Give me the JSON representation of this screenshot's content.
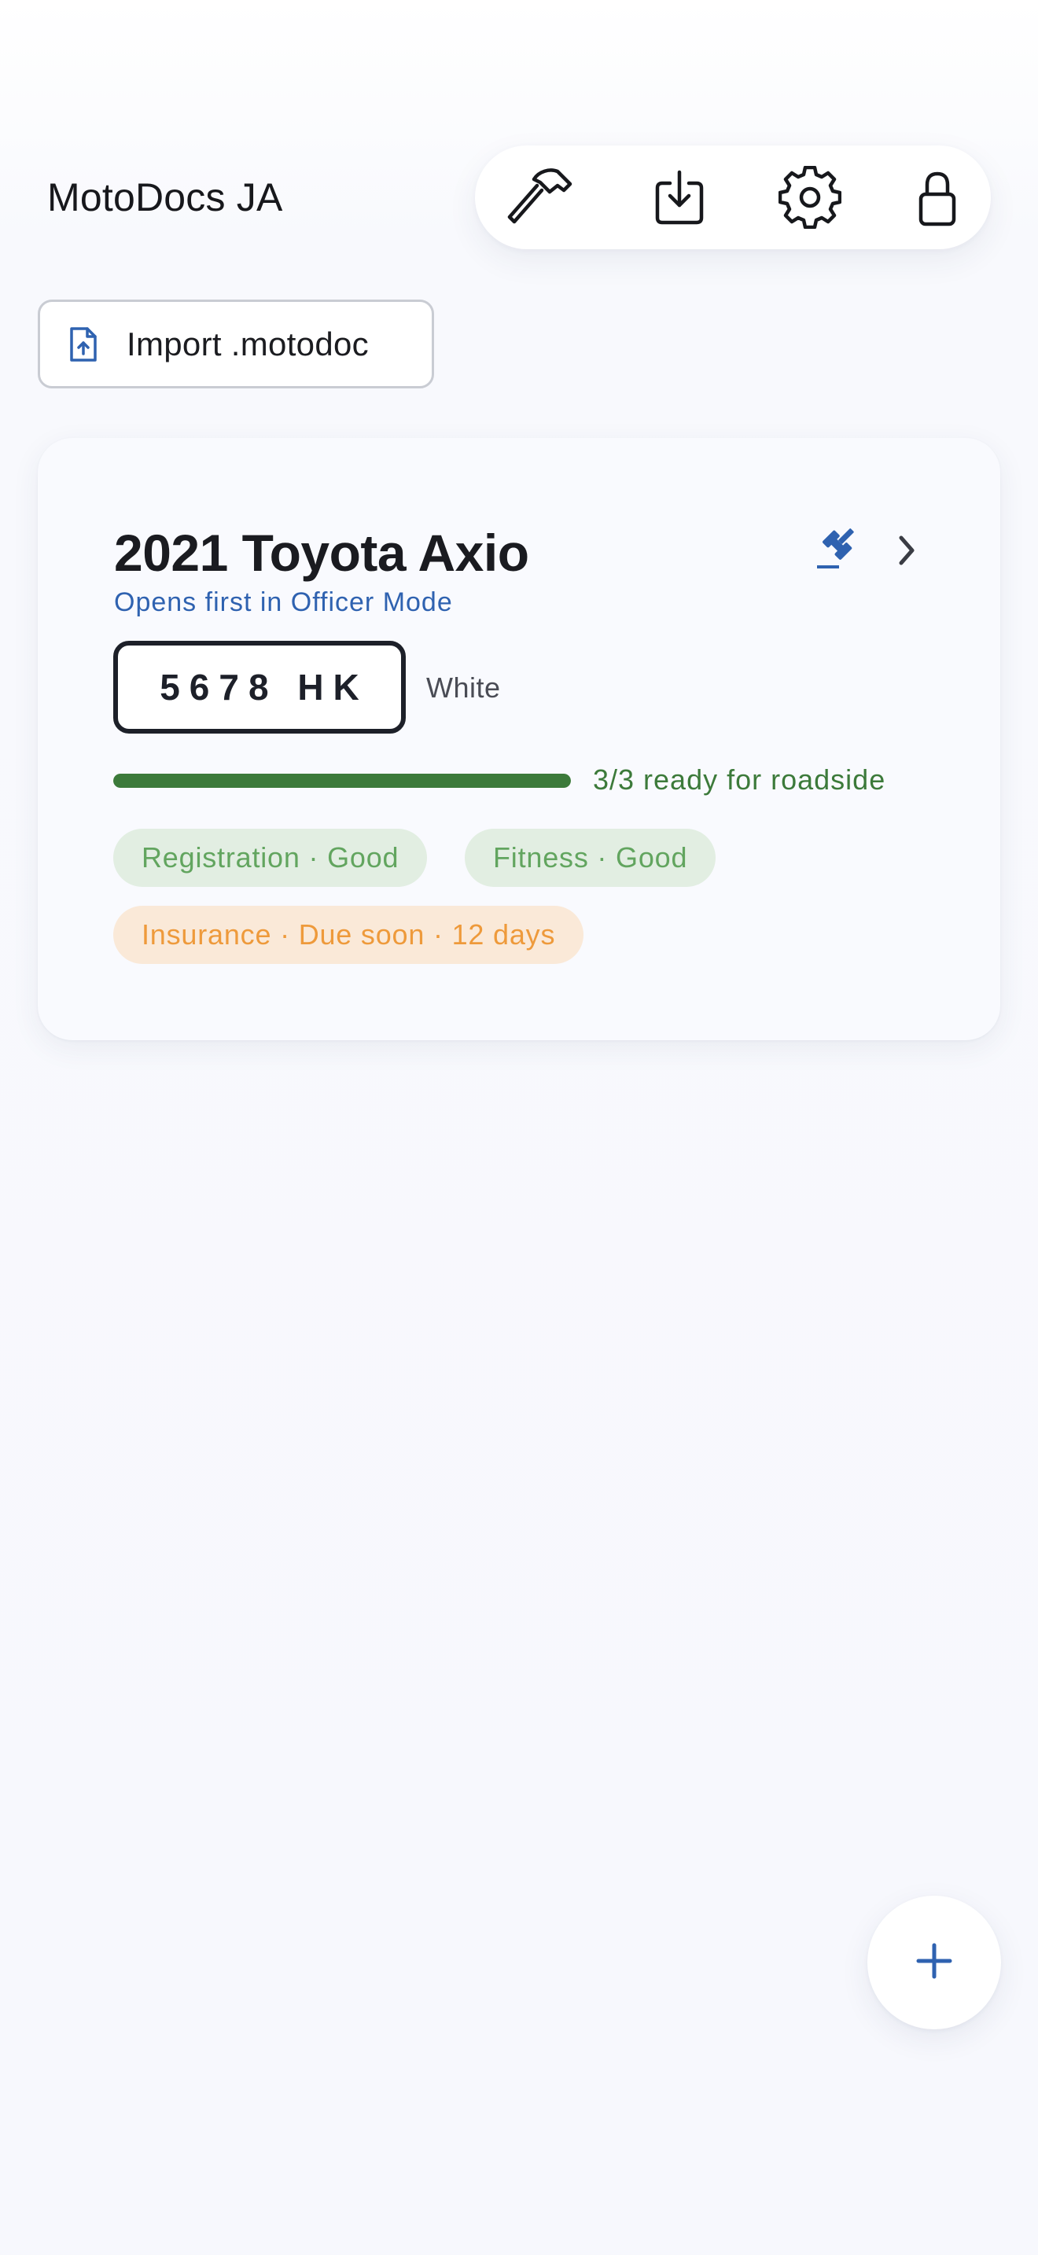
{
  "app": {
    "title": "MotoDocs JA"
  },
  "toolbar": {
    "buttons": [
      {
        "icon": "hammer-icon"
      },
      {
        "icon": "download-icon"
      },
      {
        "icon": "gear-icon"
      },
      {
        "icon": "lock-icon"
      }
    ]
  },
  "import_button": {
    "label": "Import .motodoc",
    "icon": "file-upload-icon"
  },
  "vehicle_card": {
    "title": "2021 Toyota Axio",
    "note": "Opens first in Officer Mode",
    "plate": "5678 HK",
    "color": "White",
    "readiness": {
      "text": "3/3 ready for roadside",
      "ready": 3,
      "total": 3
    },
    "chips": [
      {
        "label": "Registration · Good",
        "status": "good"
      },
      {
        "label": "Fitness · Good",
        "status": "good"
      },
      {
        "label": "Insurance · Due soon · 12 days",
        "status": "due_soon"
      }
    ]
  },
  "fab": {
    "icon": "plus-icon"
  },
  "colors": {
    "accent": "#2f62b0",
    "good": "#3c7a3a",
    "good_chip_text": "#62a55f",
    "warn_chip_text": "#ee9a3b"
  }
}
